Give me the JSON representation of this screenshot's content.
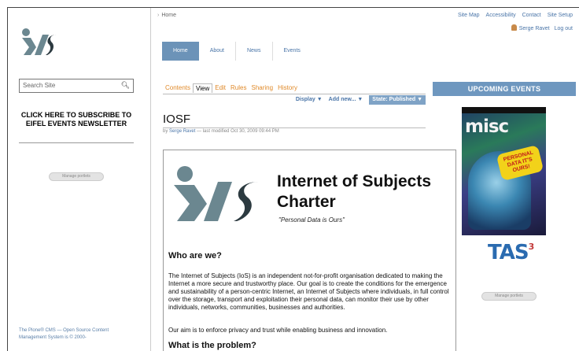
{
  "site": {
    "logo_text": "iOS"
  },
  "breadcrumb": {
    "home": "Home"
  },
  "toplinks": [
    "Site Map",
    "Accessibility",
    "Contact",
    "Site Setup"
  ],
  "user": {
    "name": "Serge Ravet",
    "logout": "Log out"
  },
  "nav": {
    "tabs": [
      "Home",
      "About",
      "News",
      "Events"
    ]
  },
  "search": {
    "placeholder": "Search Site"
  },
  "subscribe": {
    "text": "CLICK HERE TO SUBSCRIBE TO EIFEL EVENTS NEWSLETTER"
  },
  "portlets": {
    "manage_label": "Manage portlets"
  },
  "footer": {
    "text": "The Plone® CMS — Open Source Content Management System is © 2000-"
  },
  "content_tabs": [
    "Contents",
    "View",
    "Edit",
    "Rules",
    "Sharing",
    "History"
  ],
  "content_bar": {
    "display": "Display ▼",
    "add_new": "Add new... ▼",
    "state": "State: Published ▼"
  },
  "page": {
    "title": "IOSF",
    "author": "Serge Ravet",
    "modified": "— last modified Oct 30, 2009 09:44 PM"
  },
  "doc": {
    "title": "Internet of Subjects Charter",
    "subtitle": "\"Personal Data is Ours\"",
    "h_who": "Who are we?",
    "p1": "The Internet of Subjects (IoS) is an independent not-for-profit organisation dedicated to making the Internet a more secure and trustworthy place. Our goal is to create the conditions for the emergence and sustainability of a person-centric Internet, an Internet of Subjects where individuals, in full control over the storage, transport and exploitation their personal data, can monitor their use by other individuals, networks, communities, businesses and authorities.",
    "p2": "Our aim is to enforce privacy and trust while enabling business and innovation.",
    "h_problem": "What is the problem?"
  },
  "events": {
    "heading": "UPCOMING EVENTS",
    "poster_title": "misc",
    "poster_tag": "PERSONAL DATA IT'S OURS!",
    "sponsor": "TAS",
    "sponsor_sup": "3"
  },
  "colors": {
    "nav_active": "#6c93b8",
    "link": "#4a75a8",
    "orange_tab": "#e08a2a",
    "event_head": "#6e97bf"
  }
}
